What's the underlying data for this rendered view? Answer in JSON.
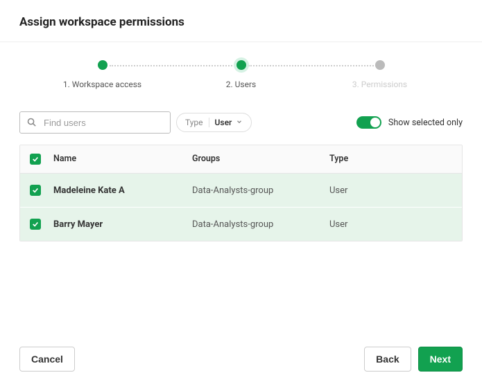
{
  "header": {
    "title": "Assign workspace permissions"
  },
  "stepper": {
    "steps": [
      {
        "number": "1.",
        "label": "Workspace access",
        "state": "done"
      },
      {
        "number": "2.",
        "label": "Users",
        "state": "active"
      },
      {
        "number": "3.",
        "label": "Permissions",
        "state": "inactive"
      }
    ]
  },
  "controls": {
    "search_placeholder": "Find users",
    "type_label": "Type",
    "type_value": "User",
    "toggle_label": "Show selected only",
    "toggle_on": true
  },
  "table": {
    "columns": {
      "name": "Name",
      "groups": "Groups",
      "type": "Type"
    },
    "rows": [
      {
        "checked": true,
        "name": "Madeleine Kate A",
        "groups": "Data-Analysts-group",
        "type": "User"
      },
      {
        "checked": true,
        "name": "Barry Mayer",
        "groups": "Data-Analysts-group",
        "type": "User"
      }
    ]
  },
  "footer": {
    "cancel": "Cancel",
    "back": "Back",
    "next": "Next"
  }
}
